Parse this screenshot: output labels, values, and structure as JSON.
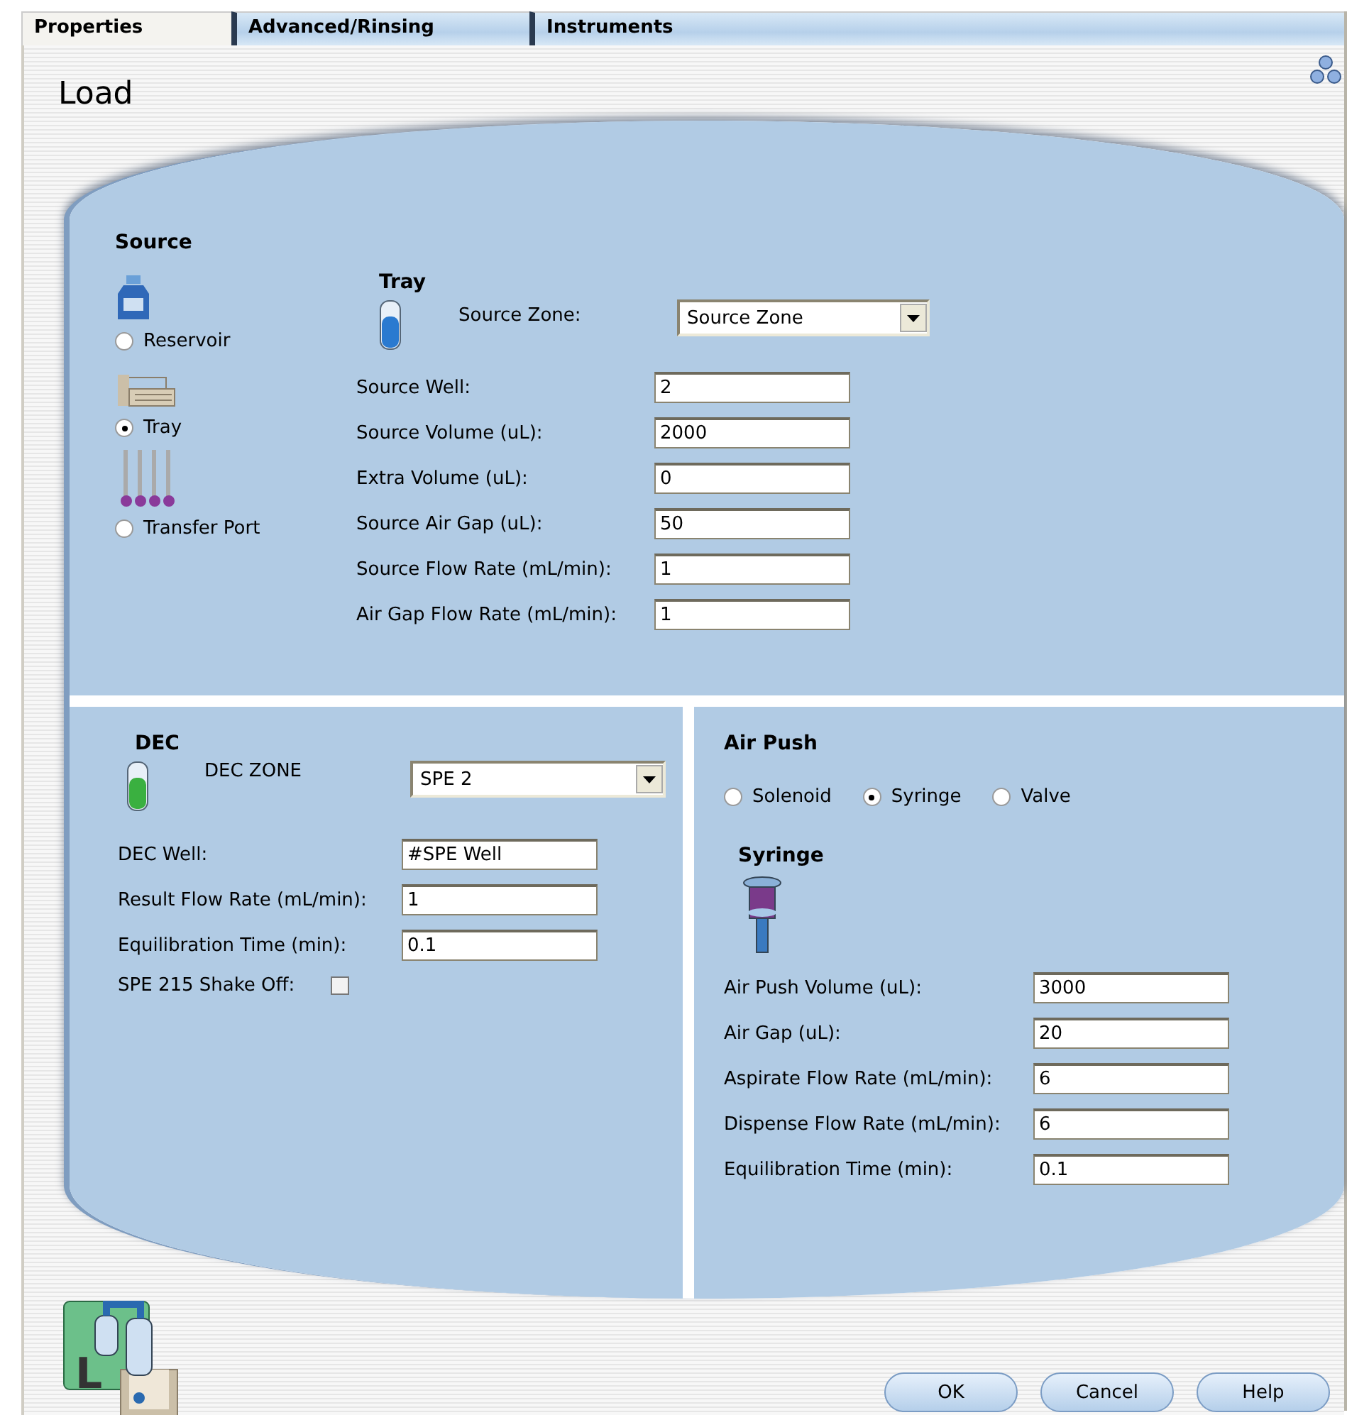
{
  "tabs": [
    {
      "label": "Properties",
      "selected": true
    },
    {
      "label": "Advanced/Rinsing",
      "selected": false
    },
    {
      "label": "Instruments",
      "selected": false
    }
  ],
  "title": "Load",
  "source": {
    "heading": "Source",
    "options": [
      {
        "label": "Reservoir",
        "kind": "bottle",
        "selected": false
      },
      {
        "label": "Tray",
        "kind": "tray",
        "selected": true
      },
      {
        "label": "Transfer Port",
        "kind": "ports",
        "selected": false
      }
    ],
    "tray_heading": "Tray",
    "zone_label": "Source Zone:",
    "zone_value": "Source Zone",
    "fields": [
      {
        "label": "Source Well:",
        "value": "2"
      },
      {
        "label": "Source Volume (uL):",
        "value": "2000"
      },
      {
        "label": "Extra Volume (uL):",
        "value": "0"
      },
      {
        "label": "Source Air Gap (uL):",
        "value": "50"
      },
      {
        "label": "Source Flow Rate (mL/min):",
        "value": "1"
      },
      {
        "label": "Air Gap Flow Rate (mL/min):",
        "value": "1"
      }
    ]
  },
  "dec": {
    "heading": "DEC",
    "zone_label": "DEC ZONE",
    "zone_value": "SPE 2",
    "fields": [
      {
        "label": "DEC Well:",
        "value": "#SPE Well"
      },
      {
        "label": "Result Flow Rate (mL/min):",
        "value": "1"
      },
      {
        "label": "Equilibration Time (min):",
        "value": "0.1"
      }
    ],
    "shake_label": "SPE 215 Shake Off:",
    "shake_checked": false
  },
  "air_push": {
    "heading": "Air Push",
    "modes": [
      {
        "label": "Solenoid",
        "selected": false
      },
      {
        "label": "Syringe",
        "selected": true
      },
      {
        "label": "Valve",
        "selected": false
      }
    ],
    "sub_heading": "Syringe",
    "fields": [
      {
        "label": "Air Push Volume (uL):",
        "value": "3000"
      },
      {
        "label": "Air Gap (uL):",
        "value": "20"
      },
      {
        "label": "Aspirate Flow Rate (mL/min):",
        "value": "6"
      },
      {
        "label": "Dispense Flow Rate (mL/min):",
        "value": "6"
      },
      {
        "label": "Equilibration Time (min):",
        "value": "0.1"
      }
    ]
  },
  "logo_letter": "L",
  "buttons": [
    "OK",
    "Cancel",
    "Help"
  ]
}
